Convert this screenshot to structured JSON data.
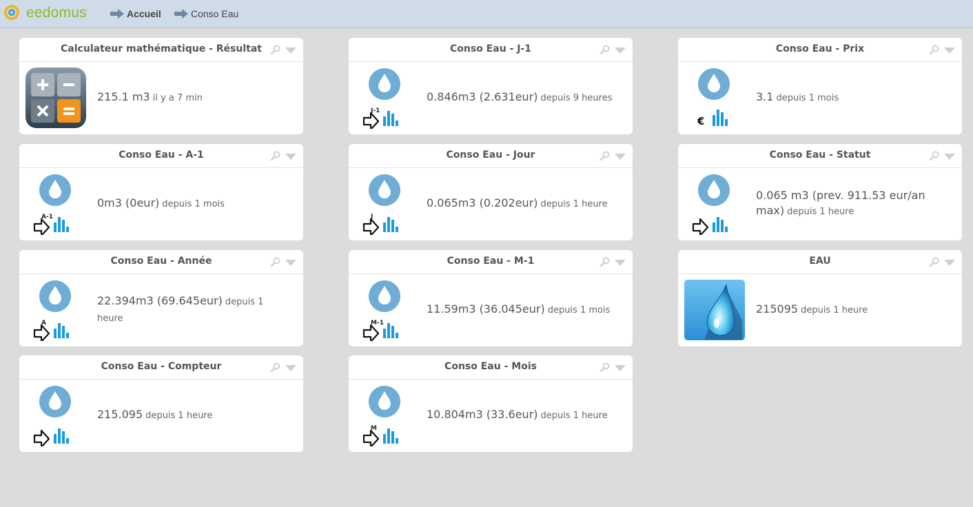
{
  "header": {
    "logo_text": "eedomus",
    "breadcrumbs": [
      {
        "label": "Accueil"
      },
      {
        "label": "Conso Eau"
      }
    ]
  },
  "colors": {
    "topbar": "#cfdbe9",
    "background": "#dcdcdc",
    "drop": "#6fadd6",
    "bars": "#1b9ae0",
    "logo_green": "#8dbb25"
  },
  "widgets": [
    {
      "title": "Calculateur mathématique - Résultat",
      "value": "215.1 m3",
      "ago": "il y a 7 min",
      "icon": "calculator-icon"
    },
    {
      "title": "Conso Eau - J-1",
      "value": "0.846m3 (2.631eur)",
      "ago": "depuis 9 heures",
      "icon": "water-stats-icon",
      "icon_label": "J-1"
    },
    {
      "title": "Conso Eau - Prix",
      "value": "3.1",
      "ago": "depuis 1 mois",
      "icon": "water-price-icon",
      "icon_label": "€"
    },
    {
      "title": "Conso Eau - A-1",
      "value": "0m3 (0eur)",
      "ago": "depuis 1 mois",
      "icon": "water-stats-icon",
      "icon_label": "A-1"
    },
    {
      "title": "Conso Eau - Jour",
      "value": "0.065m3 (0.202eur)",
      "ago": "depuis 1 heure",
      "icon": "water-stats-icon",
      "icon_label": "J"
    },
    {
      "title": "Conso Eau - Statut",
      "value": "0.065 m3 (prev. 911.53 eur/an max)",
      "ago": "depuis 1 heure",
      "icon": "water-stats-icon",
      "icon_label": ""
    },
    {
      "title": "Conso Eau - Année",
      "value": "22.394m3 (69.645eur)",
      "ago": "depuis 1 heure",
      "icon": "water-stats-icon",
      "icon_label": "A"
    },
    {
      "title": "Conso Eau - M-1",
      "value": "11.59m3 (36.045eur)",
      "ago": "depuis 1 mois",
      "icon": "water-stats-icon",
      "icon_label": "M-1"
    },
    {
      "title": "EAU",
      "value": "215095",
      "ago": "depuis 1 heure",
      "icon": "water-drop-icon"
    },
    {
      "title": "Conso Eau - Compteur",
      "value": "215.095",
      "ago": "depuis 1 heure",
      "icon": "water-stats-icon",
      "icon_label": ""
    },
    {
      "title": "Conso Eau - Mois",
      "value": "10.804m3 (33.6eur)",
      "ago": "depuis 1 heure",
      "icon": "water-stats-icon",
      "icon_label": "M"
    }
  ]
}
